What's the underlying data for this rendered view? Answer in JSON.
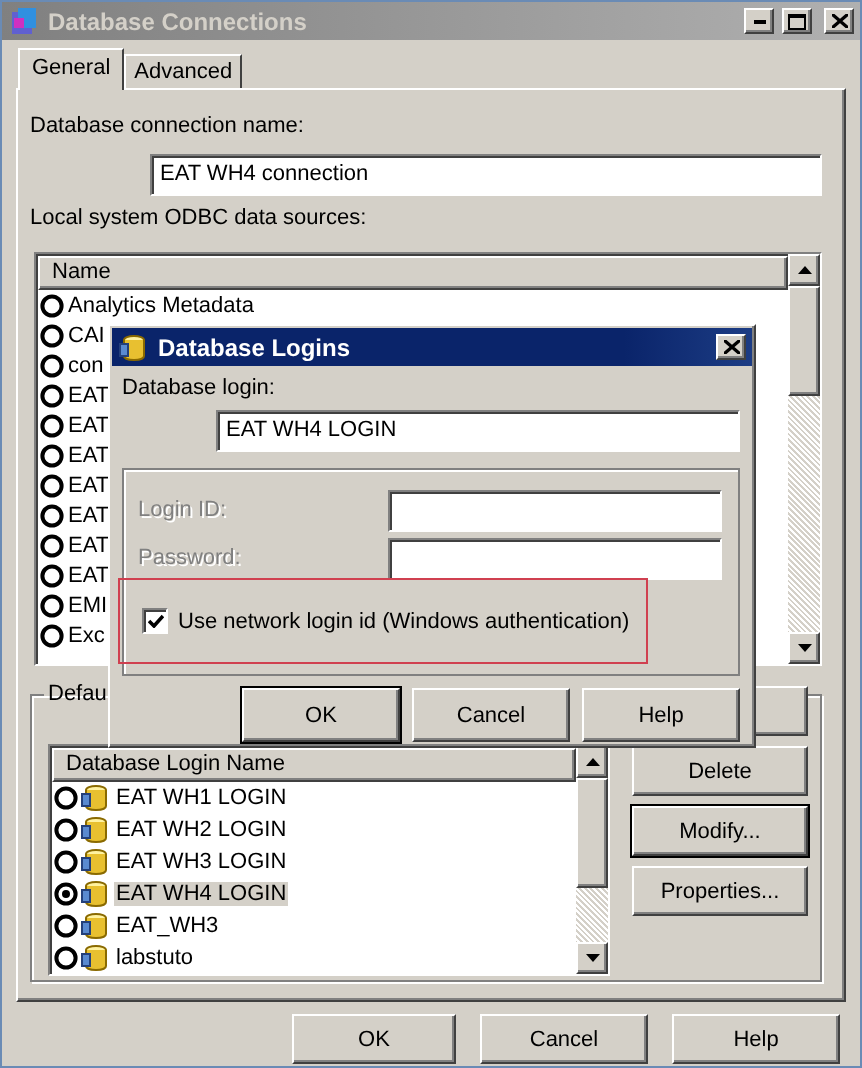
{
  "window": {
    "title": "Database Connections"
  },
  "tabs": [
    {
      "label": "General",
      "selected": true
    },
    {
      "label": "Advanced",
      "selected": false
    }
  ],
  "connection_name": {
    "label": "Database connection name:",
    "value": "EAT WH4 connection"
  },
  "data_sources": {
    "label": "Local system ODBC data sources:",
    "column": "Name",
    "rows": [
      {
        "label": "Analytics  Metadata",
        "selected": false
      },
      {
        "label": "CAI",
        "selected": false
      },
      {
        "label": "con",
        "selected": false
      },
      {
        "label": "EAT",
        "selected": false
      },
      {
        "label": "EAT",
        "selected": false
      },
      {
        "label": "EAT",
        "selected": false
      },
      {
        "label": "EAT",
        "selected": false
      },
      {
        "label": "EAT",
        "selected": false
      },
      {
        "label": "EAT",
        "selected": false
      },
      {
        "label": "EAT",
        "selected": false
      },
      {
        "label": "EMI",
        "selected": false
      },
      {
        "label": "Exc",
        "selected": false
      }
    ]
  },
  "logins_group": {
    "legend": "Defau",
    "column": "Database Login Name",
    "rows": [
      {
        "label": "EAT WH1 LOGIN",
        "selected": false
      },
      {
        "label": "EAT WH2 LOGIN",
        "selected": false
      },
      {
        "label": "EAT WH3 LOGIN",
        "selected": false
      },
      {
        "label": "EAT WH4 LOGIN",
        "selected": true
      },
      {
        "label": "EAT_WH3",
        "selected": false
      },
      {
        "label": "labstuto",
        "selected": false
      }
    ],
    "buttons": [
      {
        "label": "Delete",
        "focused": false
      },
      {
        "label": "Modify...",
        "focused": true
      },
      {
        "label": "Properties...",
        "focused": false
      }
    ]
  },
  "dialog": {
    "title": "Database Logins",
    "login_label": "Database login:",
    "login_value": "EAT WH4 LOGIN",
    "fields": [
      {
        "label": "Login ID:",
        "disabled": true
      },
      {
        "label": "Password:",
        "disabled": true
      }
    ],
    "checkbox": {
      "label": "Use network login id (Windows authentication)",
      "checked": true,
      "highlighted": true
    },
    "buttons": [
      {
        "label": "OK",
        "focused": true
      },
      {
        "label": "Cancel",
        "focused": false
      },
      {
        "label": "Help",
        "focused": false
      }
    ]
  },
  "buttons": [
    {
      "label": "OK"
    },
    {
      "label": "Cancel"
    },
    {
      "label": "Help"
    }
  ]
}
